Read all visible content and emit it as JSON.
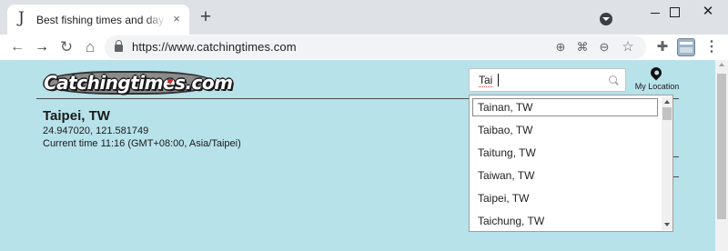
{
  "browser": {
    "tab": {
      "favicon": "fishhook-icon",
      "title": "Best fishing times and days | Ca",
      "close": "×"
    },
    "new_tab": "+",
    "window": {
      "close": "✕"
    },
    "nav": {
      "back": "←",
      "forward": "→",
      "reload": "↻",
      "home": "⌂"
    },
    "url": "https://www.catchingtimes.com"
  },
  "site": {
    "logo_text": "Catchingtimes.com",
    "location": {
      "name": "Taipei, TW",
      "coords": "24.947020, 121.581749",
      "time": "Current time 11:16 (GMT+08:00, Asia/Taipei)"
    },
    "search": {
      "value": "Tai"
    },
    "my_location_label": "My Location",
    "suggestions": [
      "Tainan, TW",
      "Taibao, TW",
      "Taitung, TW",
      "Taiwan, TW",
      "Taipei, TW",
      "Taichung, TW"
    ]
  },
  "colors": {
    "page_bg": "#b8e2ea"
  }
}
